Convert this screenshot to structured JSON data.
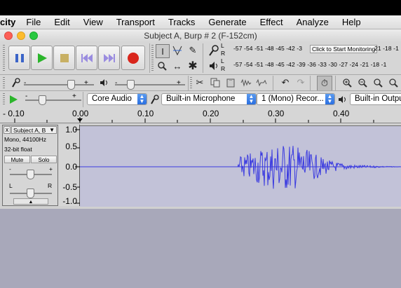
{
  "menubar": {
    "app_name": "city",
    "items": [
      "File",
      "Edit",
      "View",
      "Transport",
      "Tracks",
      "Generate",
      "Effect",
      "Analyze",
      "Help"
    ]
  },
  "window": {
    "title": "Subject A, Burp # 2 (F-152cm)"
  },
  "meters": {
    "record_scale": "-57 -54 -51 -48 -45 -42 -3",
    "record_scale_right": "21 -18 -1",
    "play_scale": "-57 -54 -51 -48 -45 -42 -39 -36 -33 -30 -27 -24 -21 -18 -1",
    "tooltip": "Click to Start Monitoring",
    "lr_left": "L",
    "lr_right": "R"
  },
  "device": {
    "host": "Core Audio",
    "input": "Built-in Microphone",
    "channels": "1 (Mono) Recor...",
    "output": "Built-in Outpu"
  },
  "ruler": {
    "labels": [
      "- 0.10",
      "0.00",
      "0.10",
      "0.20",
      "0.30",
      "0.40"
    ]
  },
  "track": {
    "name": "Subject A, B",
    "info1": "Mono, 44100Hz",
    "info2": "32-bit float",
    "mute": "Mute",
    "solo": "Solo",
    "pan_left": "L",
    "pan_right": "R",
    "gain_minus": "-",
    "gain_plus": "+",
    "close": "x",
    "scale": [
      "1.0",
      "0.5",
      "0.0",
      "-0.5",
      "-1.0"
    ]
  },
  "slider_labels": {
    "minus": "-",
    "plus": "+"
  },
  "colors": {
    "waveform": "#3a3ae0",
    "waveform_bg": "#c2c2d8",
    "below_tracks": "#a8a8ba",
    "play_green": "#2bb52b",
    "record_red": "#d9261c",
    "pause_blue": "#3b64c8"
  }
}
